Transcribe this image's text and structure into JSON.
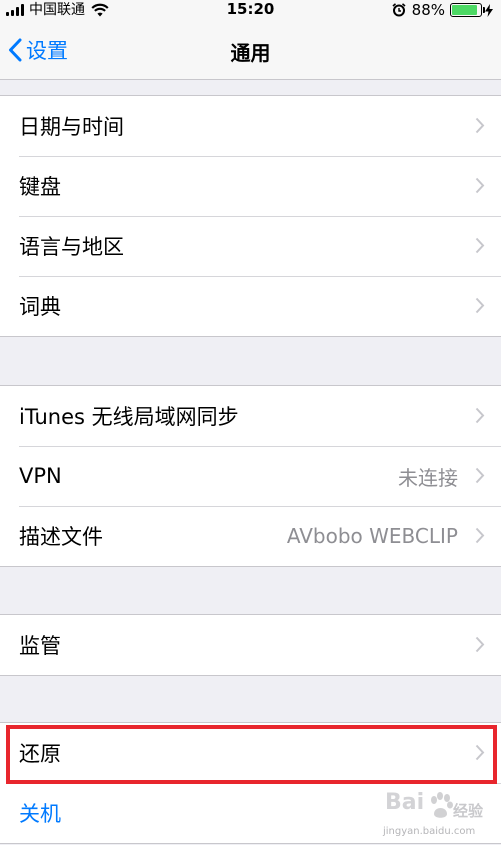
{
  "status_bar": {
    "carrier": "中国联通",
    "time": "15:20",
    "battery": "88%",
    "battery_level": 0.88,
    "icons": [
      "signal-bars-icon",
      "wifi-icon",
      "alarm-icon",
      "battery-icon",
      "charging-bolt-icon"
    ]
  },
  "nav": {
    "back_label": "设置",
    "title": "通用"
  },
  "groups": {
    "g1": [
      "日期与时间",
      "键盘",
      "语言与地区",
      "词典"
    ],
    "g2": {
      "itunes": "iTunes 无线局域网同步",
      "vpn": "VPN",
      "vpn_value": "未连接",
      "profile": "描述文件",
      "profile_value": "AVbobo WEBCLIP"
    },
    "g3": [
      "监管"
    ],
    "g4": {
      "reset": "还原",
      "shutdown": "关机"
    }
  },
  "watermark": {
    "main": "Bai",
    "paw_text": "经验",
    "sub": "jingyan.baidu.com"
  },
  "colors": {
    "accent": "#007aff",
    "highlight": "#e8262d",
    "battery": "#4cd964",
    "background": "#efeff4"
  }
}
